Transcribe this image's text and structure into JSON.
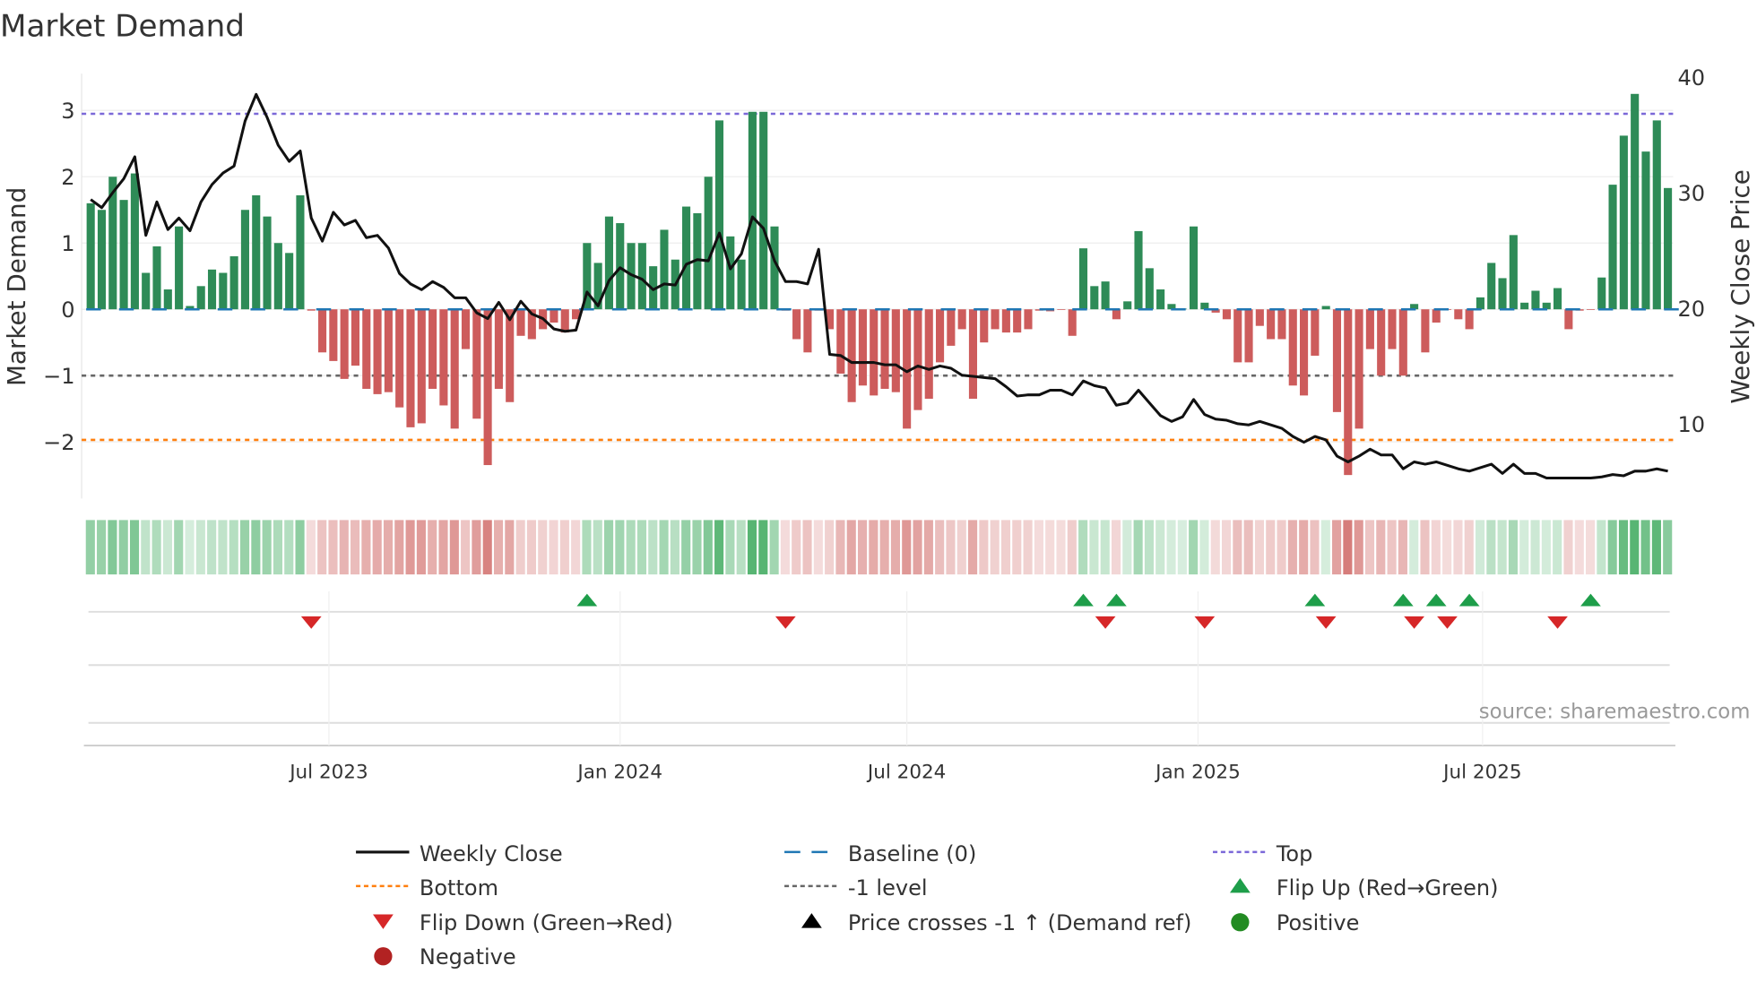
{
  "chart_data": {
    "type": "bar",
    "title": "Market Demand",
    "ylabel": "Market Demand",
    "y2label": "Weekly Close Price",
    "ylim": [
      -2.9,
      3.6
    ],
    "y2lim": [
      0,
      40
    ],
    "yticks": [
      3,
      2,
      1,
      0,
      -1,
      -2
    ],
    "ytick_labels": [
      "3",
      "2",
      "1",
      "0",
      "−1",
      "−2"
    ],
    "y2ticks": [
      40,
      30,
      20,
      10
    ],
    "y2tick_labels": [
      "40",
      "30",
      "20",
      "10"
    ],
    "xticks": [
      {
        "x": 21.6,
        "label": "Jul 2023"
      },
      {
        "x": 48.0,
        "label": "Jan 2024"
      },
      {
        "x": 74.0,
        "label": "Jul 2024"
      },
      {
        "x": 100.4,
        "label": "Jan 2025"
      },
      {
        "x": 126.2,
        "label": "Jul 2025"
      }
    ],
    "levels": {
      "top": 2.95,
      "baseline": 0,
      "minus_one": -1,
      "bottom": -1.97
    },
    "demand": [
      1.6,
      1.5,
      2.0,
      1.65,
      2.05,
      0.55,
      0.95,
      0.3,
      1.25,
      0.05,
      0.35,
      0.6,
      0.55,
      0.8,
      1.5,
      1.72,
      1.4,
      1.0,
      0.85,
      1.72,
      -0.02,
      -0.65,
      -0.78,
      -1.05,
      -0.85,
      -1.2,
      -1.28,
      -1.25,
      -1.48,
      -1.78,
      -1.72,
      -1.2,
      -1.45,
      -1.8,
      -0.6,
      -1.65,
      -2.35,
      -1.2,
      -1.4,
      -0.4,
      -0.45,
      -0.3,
      -0.2,
      -0.35,
      -0.15,
      1.0,
      0.7,
      1.4,
      1.3,
      1.0,
      1.0,
      0.65,
      1.2,
      0.75,
      1.55,
      1.45,
      2.0,
      2.85,
      1.1,
      0.75,
      2.98,
      2.98,
      1.25,
      -0.02,
      -0.45,
      -0.65,
      -0.02,
      -0.3,
      -0.97,
      -1.4,
      -1.15,
      -1.3,
      -1.2,
      -1.25,
      -1.8,
      -1.52,
      -1.35,
      -0.8,
      -0.55,
      -0.3,
      -1.35,
      -0.5,
      -0.3,
      -0.35,
      -0.35,
      -0.3,
      -0.02,
      -0.03,
      -0.01,
      -0.4,
      0.92,
      0.35,
      0.42,
      -0.15,
      0.12,
      1.18,
      0.62,
      0.3,
      0.08,
      0.01,
      1.25,
      0.1,
      -0.05,
      -0.15,
      -0.8,
      -0.8,
      -0.25,
      -0.45,
      -0.45,
      -1.15,
      -1.3,
      -0.7,
      0.05,
      -1.55,
      -2.5,
      -1.8,
      -0.6,
      -1.0,
      -0.6,
      -1.0,
      0.08,
      -0.65,
      -0.2,
      -0.01,
      -0.15,
      -0.3,
      0.18,
      0.7,
      0.47,
      1.12,
      0.1,
      0.28,
      0.1,
      0.32,
      -0.3,
      -0.02,
      -0.01,
      0.48,
      1.88,
      2.62,
      3.25,
      2.38,
      2.85,
      1.83
    ],
    "weekly_close": [
      29.4,
      28.7,
      30,
      31.2,
      33.1,
      26.3,
      29.2,
      26.8,
      27.8,
      26.7,
      29.2,
      30.7,
      31.7,
      32.3,
      36.2,
      38.5,
      36.5,
      34.1,
      32.7,
      33.6,
      27.8,
      25.8,
      28.3,
      27.2,
      27.6,
      26.1,
      26.3,
      25.2,
      23,
      22.1,
      21.6,
      22.3,
      21.8,
      20.9,
      20.9,
      19.6,
      19.1,
      20.5,
      19.0,
      20.6,
      19.5,
      19.1,
      18.2,
      18.0,
      18.1,
      21.4,
      20.2,
      22.4,
      23.5,
      22.9,
      22.5,
      21.6,
      22.1,
      22.0,
      23.8,
      24.2,
      24.1,
      26.5,
      23.4,
      24.7,
      27.9,
      26.9,
      24.1,
      22.3,
      22.3,
      22.1,
      25.1,
      16.0,
      15.9,
      15.3,
      15.3,
      15.3,
      15.1,
      15.1,
      14.5,
      15.0,
      14.7,
      15.0,
      14.8,
      14.2,
      14.1,
      14.0,
      13.9,
      13.2,
      12.4,
      12.5,
      12.5,
      12.9,
      12.9,
      12.5,
      13.7,
      13.3,
      13.1,
      11.6,
      11.8,
      12.9,
      11.8,
      10.7,
      10.2,
      10.6,
      12.1,
      10.8,
      10.4,
      10.3,
      10.0,
      9.9,
      10.2,
      9.9,
      9.6,
      8.9,
      8.4,
      8.9,
      8.6,
      7.2,
      6.7,
      7.2,
      7.8,
      7.3,
      7.3,
      6.1,
      6.7,
      6.5,
      6.7,
      6.4,
      6.1,
      5.9,
      6.2,
      6.5,
      5.7,
      6.5,
      5.7,
      5.7,
      5.3,
      5.3,
      5.3,
      5.3,
      5.3,
      5.4,
      5.6,
      5.5,
      5.9,
      5.9,
      6.1,
      5.9
    ],
    "flip_up": [
      45,
      90,
      93,
      111,
      119,
      122,
      125,
      136
    ],
    "flip_down": [
      20,
      63,
      92,
      101,
      112,
      120,
      123,
      133
    ],
    "legend": [
      {
        "label": "Weekly Close",
        "kind": "line",
        "color": "#111111"
      },
      {
        "label": "Baseline (0)",
        "kind": "dash",
        "color": "#1f77b4"
      },
      {
        "label": "Top",
        "kind": "dot",
        "color": "#7b68d8"
      },
      {
        "label": "Bottom",
        "kind": "dot",
        "color": "#ff7f0e"
      },
      {
        "label": "-1 level",
        "kind": "dot",
        "color": "#666666"
      },
      {
        "label": "Flip Up (Red→Green)",
        "kind": "up",
        "color": "#1e9e4a"
      },
      {
        "label": "Flip Down (Green→Red)",
        "kind": "down",
        "color": "#d62728"
      },
      {
        "label": "Price crosses -1 ↑ (Demand ref)",
        "kind": "up",
        "color": "#000000"
      },
      {
        "label": "Positive",
        "kind": "circle",
        "color": "#228b22"
      },
      {
        "label": "Negative",
        "kind": "circle",
        "color": "#b22222"
      }
    ],
    "legend_position": "bottom-center",
    "colors": {
      "positive": "#2e8b57",
      "negative": "#cd5c5c"
    },
    "source": "source: sharemaestro.com"
  }
}
